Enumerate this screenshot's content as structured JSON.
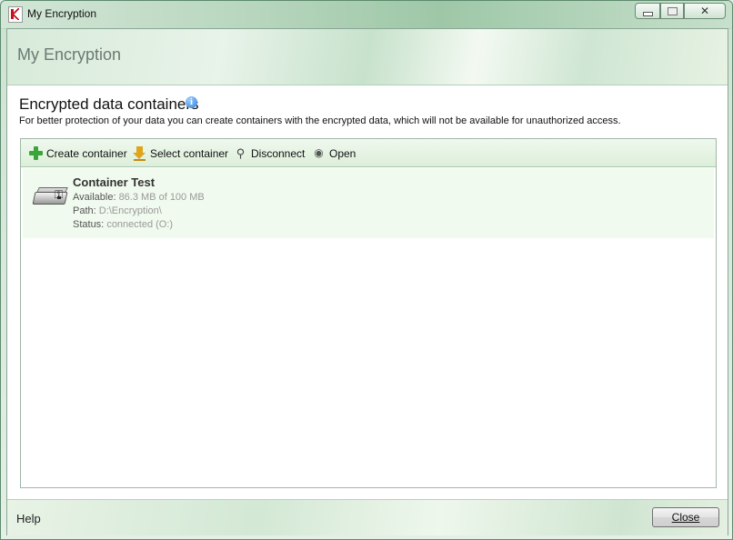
{
  "window": {
    "title": "My Encryption",
    "controls": {
      "minimize": "",
      "maximize": "",
      "close": "✕"
    }
  },
  "banner": {
    "title": "My Encryption"
  },
  "section": {
    "title": "Encrypted data containers",
    "info_icon": "i",
    "description": "For better protection of your data you can create containers with the encrypted data, which will not be available for unauthorized access."
  },
  "toolbar": {
    "create_label": "Create container",
    "select_label": "Select container",
    "disconnect_label": "Disconnect",
    "open_label": "Open"
  },
  "containers": [
    {
      "name": "Container Test",
      "available_label": "Available:",
      "available_value": "86.3 MB of 100 MB",
      "path_label": "Path:",
      "path_value": "D:\\Encryption\\",
      "status_label": "Status:",
      "status_value": "connected (O:)",
      "icon": "encrypted-drive-icon"
    }
  ],
  "footer": {
    "help_label": "Help",
    "close_label": "Close"
  }
}
